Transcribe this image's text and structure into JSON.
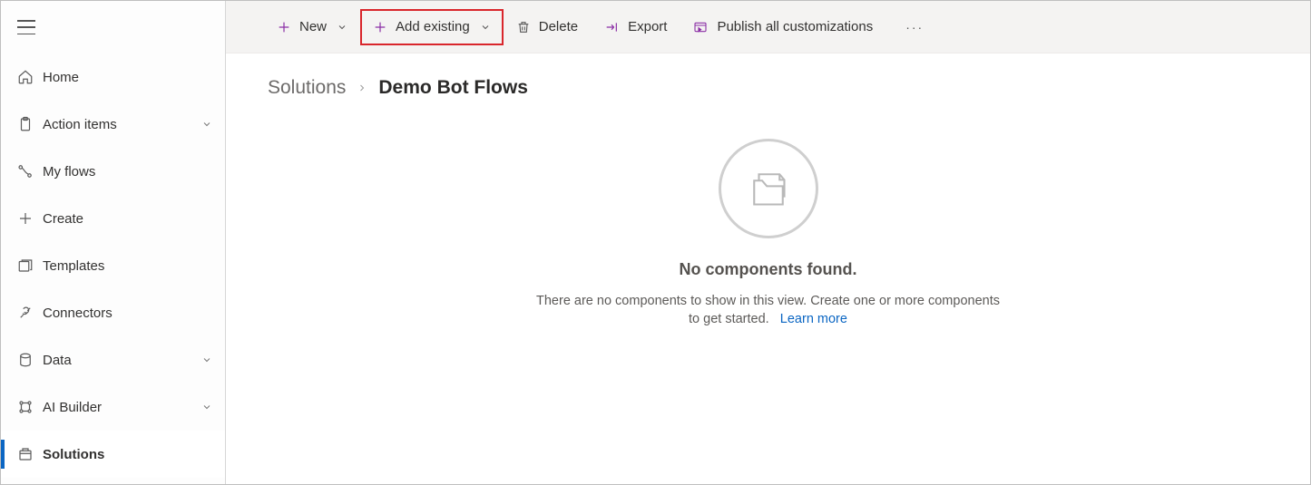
{
  "sidebar": {
    "items": [
      {
        "label": "Home",
        "icon": "home",
        "expandable": false,
        "active": false
      },
      {
        "label": "Action items",
        "icon": "clipboard",
        "expandable": true,
        "active": false
      },
      {
        "label": "My flows",
        "icon": "flow",
        "expandable": false,
        "active": false
      },
      {
        "label": "Create",
        "icon": "plus",
        "expandable": false,
        "active": false
      },
      {
        "label": "Templates",
        "icon": "templates",
        "expandable": false,
        "active": false
      },
      {
        "label": "Connectors",
        "icon": "connectors",
        "expandable": false,
        "active": false
      },
      {
        "label": "Data",
        "icon": "data",
        "expandable": true,
        "active": false
      },
      {
        "label": "AI Builder",
        "icon": "ai",
        "expandable": true,
        "active": false
      },
      {
        "label": "Solutions",
        "icon": "solutions",
        "expandable": false,
        "active": true
      }
    ]
  },
  "toolbar": {
    "new_label": "New",
    "add_existing_label": "Add existing",
    "delete_label": "Delete",
    "export_label": "Export",
    "publish_label": "Publish all customizations"
  },
  "breadcrumb": {
    "root": "Solutions",
    "current": "Demo Bot Flows"
  },
  "empty": {
    "title": "No components found.",
    "desc": "There are no components to show in this view. Create one or more components to get started.",
    "link": "Learn more"
  }
}
